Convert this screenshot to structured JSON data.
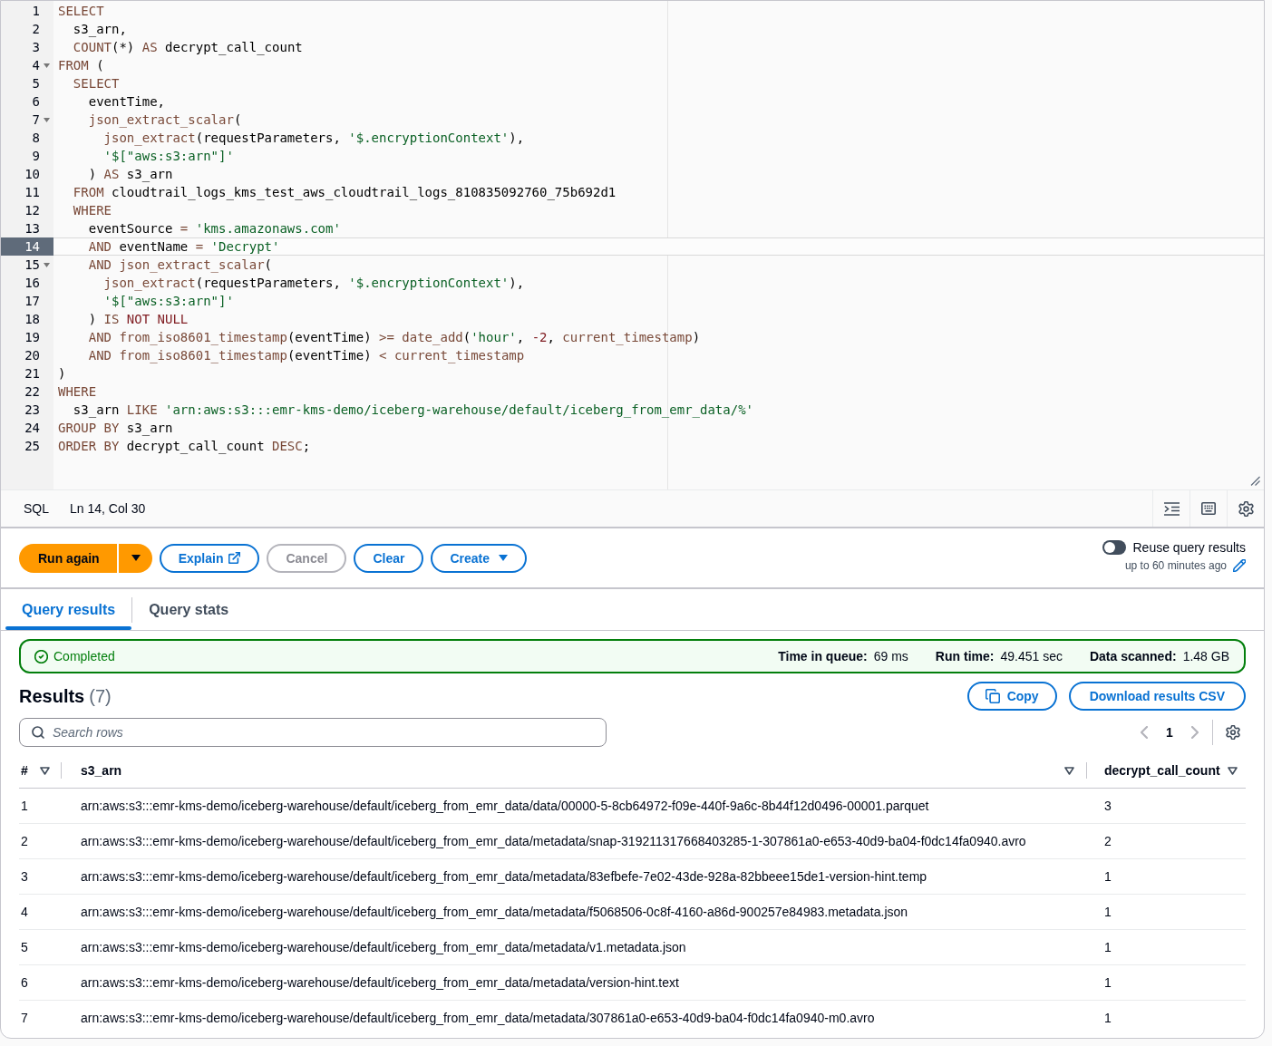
{
  "editor": {
    "lines": [
      {
        "number": "1",
        "foldable": false,
        "active": false,
        "tokens": [
          {
            "kind": "keyword",
            "text": "SELECT"
          }
        ]
      },
      {
        "number": "2",
        "foldable": false,
        "active": false,
        "tokens": [
          {
            "kind": "plain",
            "text": "  s3_arn,"
          }
        ]
      },
      {
        "number": "3",
        "foldable": false,
        "active": false,
        "tokens": [
          {
            "kind": "keyword",
            "text": "  COUNT"
          },
          {
            "kind": "plain",
            "text": "(*) "
          },
          {
            "kind": "keyword",
            "text": "AS"
          },
          {
            "kind": "plain",
            "text": " decrypt_call_count"
          }
        ]
      },
      {
        "number": "4",
        "foldable": true,
        "active": false,
        "tokens": [
          {
            "kind": "keyword",
            "text": "FROM"
          },
          {
            "kind": "plain",
            "text": " ("
          }
        ]
      },
      {
        "number": "5",
        "foldable": false,
        "active": false,
        "tokens": [
          {
            "kind": "keyword",
            "text": "  SELECT"
          }
        ]
      },
      {
        "number": "6",
        "foldable": false,
        "active": false,
        "tokens": [
          {
            "kind": "plain",
            "text": "    eventTime,"
          }
        ]
      },
      {
        "number": "7",
        "foldable": true,
        "active": false,
        "tokens": [
          {
            "kind": "keyword",
            "text": "    json_extract_scalar"
          },
          {
            "kind": "plain",
            "text": "("
          }
        ]
      },
      {
        "number": "8",
        "foldable": false,
        "active": false,
        "tokens": [
          {
            "kind": "keyword",
            "text": "      json_extract"
          },
          {
            "kind": "plain",
            "text": "(requestParameters, "
          },
          {
            "kind": "string",
            "text": "'$.encryptionContext'"
          },
          {
            "kind": "plain",
            "text": "),"
          }
        ]
      },
      {
        "number": "9",
        "foldable": false,
        "active": false,
        "tokens": [
          {
            "kind": "string",
            "text": "      '$[\"aws:s3:arn\"]'"
          }
        ]
      },
      {
        "number": "10",
        "foldable": false,
        "active": false,
        "tokens": [
          {
            "kind": "plain",
            "text": "    ) "
          },
          {
            "kind": "keyword",
            "text": "AS"
          },
          {
            "kind": "plain",
            "text": " s3_arn"
          }
        ]
      },
      {
        "number": "11",
        "foldable": false,
        "active": false,
        "tokens": [
          {
            "kind": "keyword",
            "text": "  FROM"
          },
          {
            "kind": "plain",
            "text": " cloudtrail_logs_kms_test_aws_cloudtrail_logs_810835092760_75b692d1"
          }
        ]
      },
      {
        "number": "12",
        "foldable": false,
        "active": false,
        "tokens": [
          {
            "kind": "keyword",
            "text": "  WHERE"
          }
        ]
      },
      {
        "number": "13",
        "foldable": false,
        "active": false,
        "tokens": [
          {
            "kind": "plain",
            "text": "    eventSource "
          },
          {
            "kind": "keyword",
            "text": "="
          },
          {
            "kind": "string",
            "text": " 'kms.amazonaws.com'"
          }
        ]
      },
      {
        "number": "14",
        "foldable": false,
        "active": true,
        "tokens": [
          {
            "kind": "keyword",
            "text": "    AND"
          },
          {
            "kind": "plain",
            "text": " eventName "
          },
          {
            "kind": "keyword",
            "text": "="
          },
          {
            "kind": "string",
            "text": " 'Decrypt'"
          }
        ]
      },
      {
        "number": "15",
        "foldable": true,
        "active": false,
        "tokens": [
          {
            "kind": "keyword",
            "text": "    AND json_extract_scalar"
          },
          {
            "kind": "plain",
            "text": "("
          }
        ]
      },
      {
        "number": "16",
        "foldable": false,
        "active": false,
        "tokens": [
          {
            "kind": "keyword",
            "text": "      json_extract"
          },
          {
            "kind": "plain",
            "text": "(requestParameters, "
          },
          {
            "kind": "string",
            "text": "'$.encryptionContext'"
          },
          {
            "kind": "plain",
            "text": "),"
          }
        ]
      },
      {
        "number": "17",
        "foldable": false,
        "active": false,
        "tokens": [
          {
            "kind": "string",
            "text": "      '$[\"aws:s3:arn\"]'"
          }
        ]
      },
      {
        "number": "18",
        "foldable": false,
        "active": false,
        "tokens": [
          {
            "kind": "plain",
            "text": "    ) "
          },
          {
            "kind": "keyword",
            "text": "IS"
          },
          {
            "kind": "constant",
            "text": " NOT NULL"
          }
        ]
      },
      {
        "number": "19",
        "foldable": false,
        "active": false,
        "tokens": [
          {
            "kind": "keyword",
            "text": "    AND from_iso8601_timestamp"
          },
          {
            "kind": "plain",
            "text": "(eventTime) "
          },
          {
            "kind": "keyword",
            "text": ">= date_add"
          },
          {
            "kind": "plain",
            "text": "("
          },
          {
            "kind": "string",
            "text": "'hour'"
          },
          {
            "kind": "plain",
            "text": ", "
          },
          {
            "kind": "constant",
            "text": "-2"
          },
          {
            "kind": "plain",
            "text": ", "
          },
          {
            "kind": "keyword",
            "text": "current_timestamp"
          },
          {
            "kind": "plain",
            "text": ")"
          }
        ]
      },
      {
        "number": "20",
        "foldable": false,
        "active": false,
        "tokens": [
          {
            "kind": "keyword",
            "text": "    AND from_iso8601_timestamp"
          },
          {
            "kind": "plain",
            "text": "(eventTime) "
          },
          {
            "kind": "keyword",
            "text": "< current_timestamp"
          }
        ]
      },
      {
        "number": "21",
        "foldable": false,
        "active": false,
        "tokens": [
          {
            "kind": "plain",
            "text": ")"
          }
        ]
      },
      {
        "number": "22",
        "foldable": false,
        "active": false,
        "tokens": [
          {
            "kind": "keyword",
            "text": "WHERE"
          }
        ]
      },
      {
        "number": "23",
        "foldable": false,
        "active": false,
        "tokens": [
          {
            "kind": "plain",
            "text": "  s3_arn "
          },
          {
            "kind": "keyword",
            "text": "LIKE"
          },
          {
            "kind": "string",
            "text": " 'arn:aws:s3:::emr-kms-demo/iceberg-warehouse/default/iceberg_from_emr_data/%'"
          }
        ]
      },
      {
        "number": "24",
        "foldable": false,
        "active": false,
        "tokens": [
          {
            "kind": "keyword",
            "text": "GROUP BY"
          },
          {
            "kind": "plain",
            "text": " s3_arn"
          }
        ]
      },
      {
        "number": "25",
        "foldable": false,
        "active": false,
        "tokens": [
          {
            "kind": "keyword",
            "text": "ORDER BY"
          },
          {
            "kind": "plain",
            "text": " decrypt_call_count "
          },
          {
            "kind": "keyword",
            "text": "DESC"
          },
          {
            "kind": "plain",
            "text": ";"
          }
        ]
      }
    ]
  },
  "status_bar": {
    "language": "SQL",
    "cursor": "Ln 14, Col 30"
  },
  "actions": {
    "buttons": [
      {
        "label": "Run again",
        "kind": "split",
        "disabled": false
      },
      {
        "label": "Explain",
        "kind": "external",
        "disabled": false
      },
      {
        "label": "Cancel",
        "kind": "normal",
        "disabled": true
      },
      {
        "label": "Clear",
        "kind": "normal",
        "disabled": false
      },
      {
        "label": "Create",
        "kind": "dropdown",
        "disabled": false
      }
    ]
  },
  "reuse_results": {
    "label": "Reuse query results",
    "on": false,
    "detail": "up to 60 minutes ago"
  },
  "tabs": [
    {
      "label": "Query results",
      "selected": true
    },
    {
      "label": "Query stats",
      "selected": false
    }
  ],
  "status": {
    "kind": "success",
    "text": "Completed",
    "stats": [
      {
        "label": "Time in queue:",
        "value": "69 ms"
      },
      {
        "label": "Run time:",
        "value": "49.451 sec"
      },
      {
        "label": "Data scanned:",
        "value": "1.48 GB"
      }
    ]
  },
  "results": {
    "title": "Results",
    "count": "(7)",
    "buttons": [
      {
        "label": "Copy",
        "kind": "copy"
      },
      {
        "label": "Download results CSV",
        "kind": "plain"
      }
    ],
    "search": {
      "placeholder": "Search rows"
    },
    "pagination": {
      "previous": {
        "disabled": true
      },
      "pages": [
        {
          "label": "1",
          "selected": true
        }
      ],
      "next": {
        "disabled": true
      }
    },
    "table": {
      "columns": [
        {
          "label": "#"
        },
        {
          "label": "s3_arn"
        },
        {
          "label": "decrypt_call_count"
        }
      ],
      "rows": [
        {
          "cells": [
            "1",
            "arn:aws:s3:::emr-kms-demo/iceberg-warehouse/default/iceberg_from_emr_data/data/00000-5-8cb64972-f09e-440f-9a6c-8b44f12d0496-00001.parquet",
            "3"
          ]
        },
        {
          "cells": [
            "2",
            "arn:aws:s3:::emr-kms-demo/iceberg-warehouse/default/iceberg_from_emr_data/metadata/snap-319211317668403285-1-307861a0-e653-40d9-ba04-f0dc14fa0940.avro",
            "2"
          ]
        },
        {
          "cells": [
            "3",
            "arn:aws:s3:::emr-kms-demo/iceberg-warehouse/default/iceberg_from_emr_data/metadata/83efbefe-7e02-43de-928a-82bbeee15de1-version-hint.temp",
            "1"
          ]
        },
        {
          "cells": [
            "4",
            "arn:aws:s3:::emr-kms-demo/iceberg-warehouse/default/iceberg_from_emr_data/metadata/f5068506-0c8f-4160-a86d-900257e84983.metadata.json",
            "1"
          ]
        },
        {
          "cells": [
            "5",
            "arn:aws:s3:::emr-kms-demo/iceberg-warehouse/default/iceberg_from_emr_data/metadata/v1.metadata.json",
            "1"
          ]
        },
        {
          "cells": [
            "6",
            "arn:aws:s3:::emr-kms-demo/iceberg-warehouse/default/iceberg_from_emr_data/metadata/version-hint.text",
            "1"
          ]
        },
        {
          "cells": [
            "7",
            "arn:aws:s3:::emr-kms-demo/iceberg-warehouse/default/iceberg_from_emr_data/metadata/307861a0-e653-40d9-ba04-f0dc14fa0940-m0.avro",
            "1"
          ]
        }
      ]
    }
  }
}
